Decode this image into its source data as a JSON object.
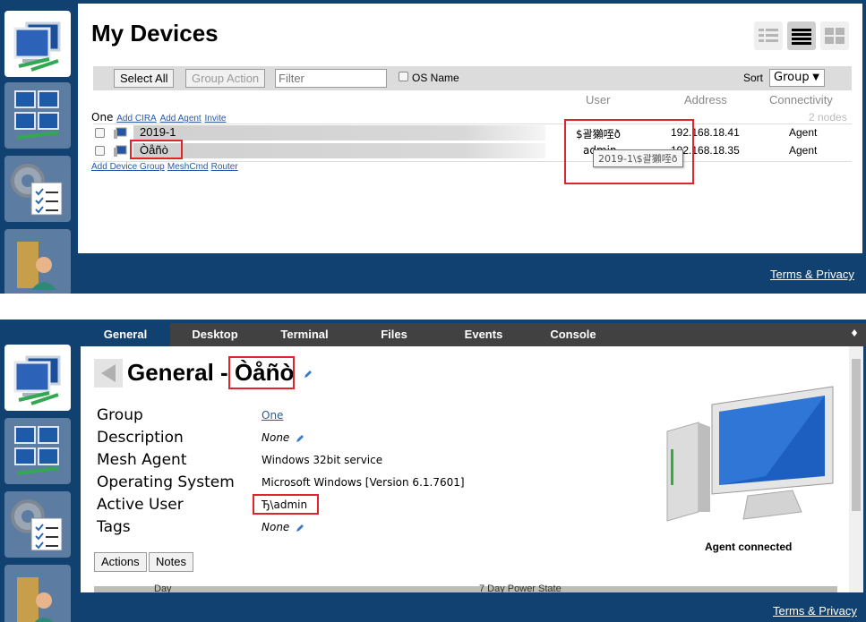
{
  "top": {
    "title": "My Devices",
    "toolbar": {
      "select_all": "Select All",
      "group_action": "Group Action",
      "filter_placeholder": "Filter",
      "os_name": "OS Name",
      "sort_label": "Sort",
      "sort_value": "Group"
    },
    "columns": {
      "user": "User",
      "address": "Address",
      "connectivity": "Connectivity"
    },
    "node_count": "2 nodes",
    "group": {
      "name": "One",
      "links": [
        "Add CIRA",
        "Add Agent",
        "Invite"
      ]
    },
    "devices": [
      {
        "name": "2019-1",
        "user": "$괄獺咥ð",
        "address": "192.168.18.41",
        "connectivity": "Agent"
      },
      {
        "name": "Òåñò",
        "user": "admin",
        "address": "192.168.18.35",
        "connectivity": "Agent"
      }
    ],
    "tooltip": "2019-1\\$괄獺咥ð",
    "bottom_links": [
      "Add Device Group",
      "MeshCmd",
      "Router"
    ],
    "footer_link": "Terms & Privacy"
  },
  "bottom": {
    "tabs": [
      "General",
      "Desktop",
      "Terminal",
      "Files",
      "Events",
      "Console"
    ],
    "tab_menu_icon": "♦",
    "title_prefix": "General - ",
    "device_name": "Òåñò",
    "fields": [
      {
        "label": "Group",
        "value": "One"
      },
      {
        "label": "Description",
        "value": "None"
      },
      {
        "label": "Mesh Agent",
        "value": "Windows 32bit service"
      },
      {
        "label": "Operating System",
        "value": "Microsoft Windows [Version 6.1.7601]"
      },
      {
        "label": "Active User",
        "value": "Ђ\\admin"
      },
      {
        "label": "Tags",
        "value": "None"
      }
    ],
    "agent_status": "Agent connected",
    "buttons": {
      "actions": "Actions",
      "notes": "Notes"
    },
    "power_table": {
      "col1": "Day",
      "col2": "7 Day Power State"
    },
    "footer_link": "Terms & Privacy"
  },
  "colors": {
    "nav": "#114170",
    "tile": "#5d7ca2",
    "highlight": "#e0242c",
    "tabbar": "#414141"
  },
  "icons": [
    "computers-icon",
    "devices-grid-icon",
    "settings-gear-icon",
    "user-folder-icon",
    "pencil-icon",
    "back-arrow-icon",
    "computer-illustration-icon"
  ]
}
